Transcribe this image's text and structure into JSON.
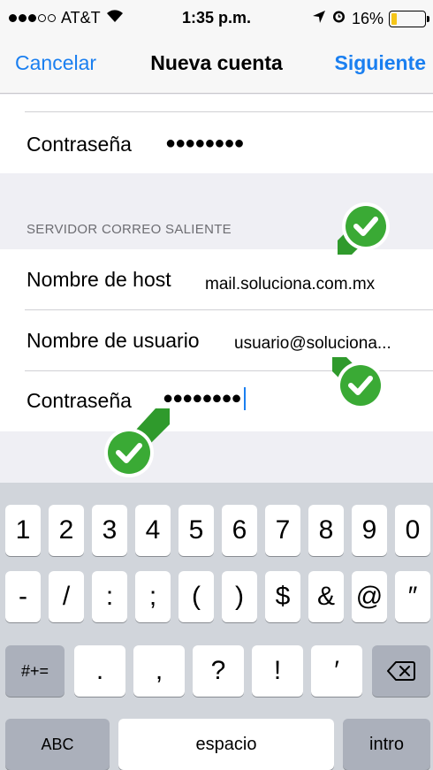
{
  "status_bar": {
    "carrier": "AT&T",
    "time": "1:35 p.m.",
    "battery_percent": "16%",
    "battery_level": 0.16,
    "icons": [
      "signal-dots-icon",
      "wifi-icon",
      "location-arrow-icon",
      "alarm-clock-icon",
      "battery-icon"
    ]
  },
  "nav": {
    "cancel_label": "Cancelar",
    "title": "Nueva cuenta",
    "next_label": "Siguiente"
  },
  "incoming": {
    "password_label": "Contraseña",
    "password_value": "●●●●●●●●"
  },
  "outgoing": {
    "section_header": "SERVIDOR CORREO SALIENTE",
    "host_label": "Nombre de host",
    "host_value": "mail.soluciona.com.mx",
    "user_label": "Nombre de usuario",
    "user_value": "usuario@soluciona...",
    "password_label": "Contraseña",
    "password_value": "●●●●●●●●"
  },
  "colors": {
    "accent": "#1a7ff0",
    "check_green": "#3aaa35",
    "battery_yellow": "#f5c518"
  },
  "keyboard": {
    "row1": [
      "1",
      "2",
      "3",
      "4",
      "5",
      "6",
      "7",
      "8",
      "9",
      "0"
    ],
    "row2": [
      "-",
      "/",
      ":",
      ";",
      "(",
      ")",
      "$",
      "&",
      "@",
      "″"
    ],
    "row3_toggle": "#+=",
    "row3": [
      ".",
      ",",
      "?",
      "!",
      "′"
    ],
    "delete_icon": "backspace-icon",
    "abc": "ABC",
    "space": "espacio",
    "return": "intro"
  }
}
